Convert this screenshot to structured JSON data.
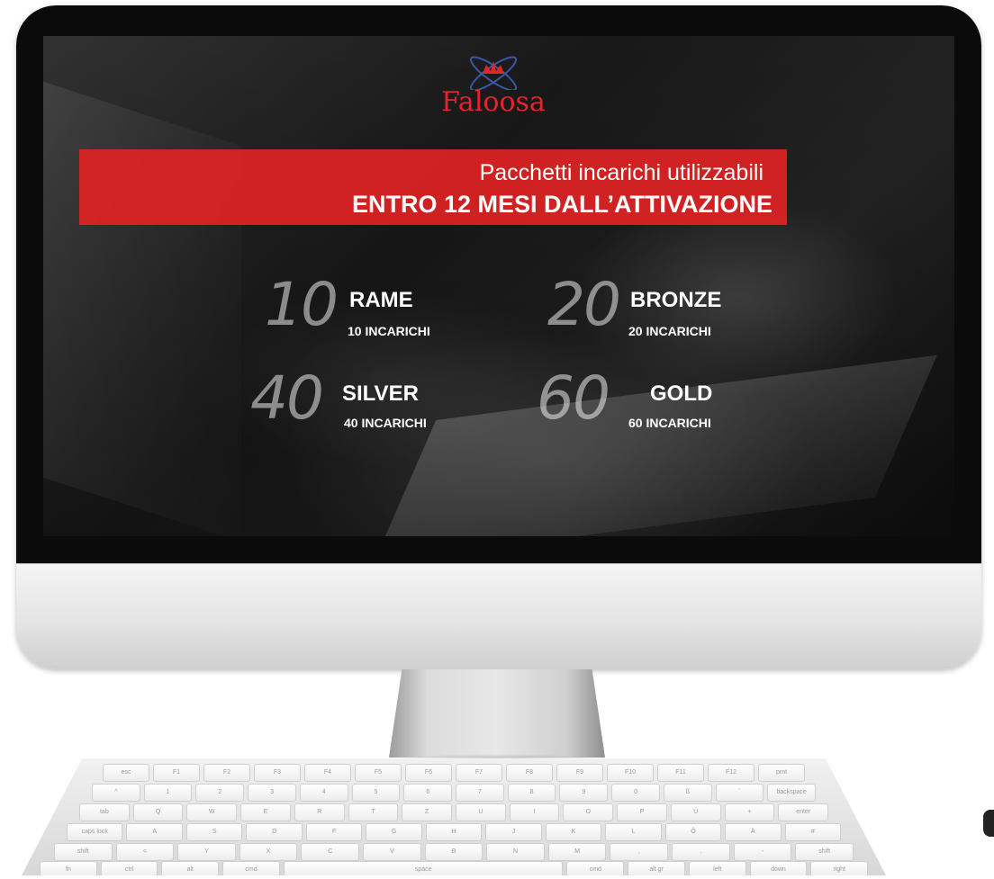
{
  "logo": {
    "text": "Faloosa"
  },
  "banner": {
    "line1": "Pacchetti incarichi utilizzabili",
    "line2": "ENTRO 12 MESI DALL’ATTIVAZIONE"
  },
  "packages": [
    {
      "number": "10",
      "name": "RAME",
      "subtitle": "10 INCARICHI"
    },
    {
      "number": "20",
      "name": "BRONZE",
      "subtitle": "20 INCARICHI"
    },
    {
      "number": "40",
      "name": "SILVER",
      "subtitle": "40 INCARICHI"
    },
    {
      "number": "60",
      "name": "GOLD",
      "subtitle": "60 INCARICHI"
    }
  ],
  "keyboard": {
    "row1": [
      "esc",
      "F1",
      "F2",
      "F3",
      "F4",
      "F5",
      "F6",
      "F7",
      "F8",
      "F9",
      "F10",
      "F11",
      "F12",
      "prnt"
    ],
    "row2": [
      "^",
      "1",
      "2",
      "3",
      "4",
      "5",
      "6",
      "7",
      "8",
      "9",
      "0",
      "ß",
      "´",
      "backspace"
    ],
    "row3": [
      "tab",
      "Q",
      "W",
      "E",
      "R",
      "T",
      "Z",
      "U",
      "I",
      "O",
      "P",
      "Ü",
      "+",
      "enter"
    ],
    "row4": [
      "caps lock",
      "A",
      "S",
      "D",
      "F",
      "G",
      "H",
      "J",
      "K",
      "L",
      "Ö",
      "Ä",
      "#"
    ],
    "row5": [
      "shift",
      "<",
      "Y",
      "X",
      "C",
      "V",
      "B",
      "N",
      "M",
      ",",
      ".",
      "-",
      "shift"
    ],
    "row6": [
      "fn",
      "ctrl",
      "alt",
      "cmd",
      "space",
      "cmd",
      "alt gr",
      "left",
      "down",
      "right"
    ]
  },
  "colors": {
    "accent": "#e0262a",
    "banner": "#e02323"
  }
}
